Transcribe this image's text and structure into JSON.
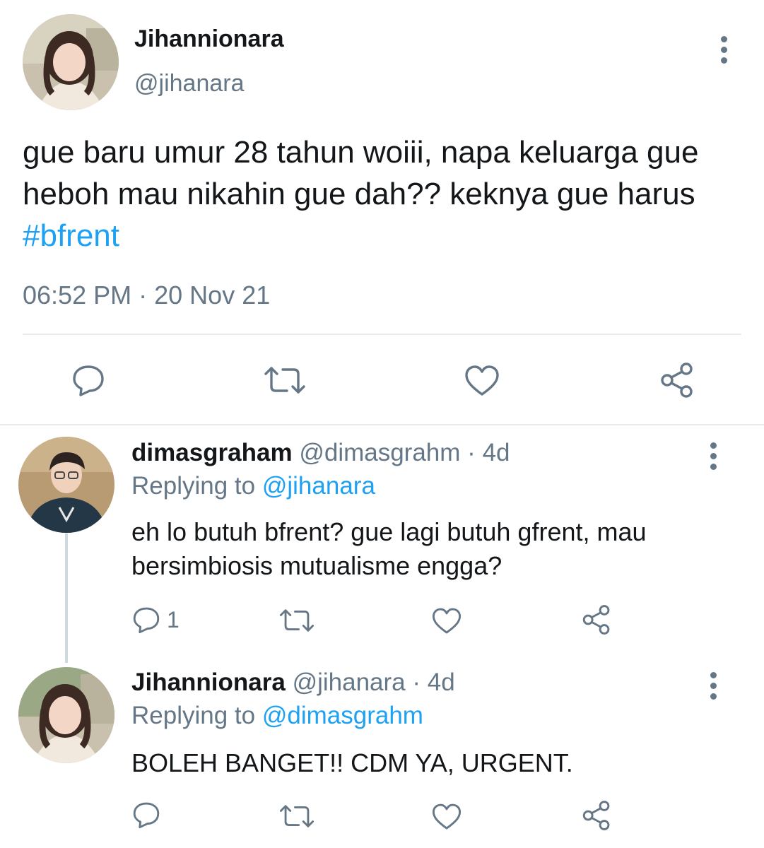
{
  "main_tweet": {
    "display_name": "Jihannionara",
    "handle": "@jihanara",
    "text_plain": "gue baru umur 28 tahun woiii, napa keluarga gue heboh mau nikahin gue dah?? keknya gue harus ",
    "hashtag": "#bfrent",
    "time": "06:52 PM",
    "separator": "·",
    "date": "20 Nov 21",
    "actions": {
      "reply": "reply-icon",
      "retweet": "retweet-icon",
      "like": "heart-icon",
      "share": "share-icon"
    }
  },
  "replies": [
    {
      "display_name": "dimasgraham",
      "handle": "@dimasgrahm",
      "separator": "·",
      "age": "4d",
      "replying_prefix": "Replying to",
      "replying_to": "@jihanara",
      "text": "eh lo butuh bfrent? gue lagi butuh gfrent, mau bersimbiosis mutualisme engga?",
      "reply_count": "1"
    },
    {
      "display_name": "Jihannionara",
      "handle": "@jihanara",
      "separator": "·",
      "age": "4d",
      "replying_prefix": "Replying to",
      "replying_to": "@dimasgrahm",
      "text": "BOLEH BANGET!! CDM YA, URGENT.",
      "reply_count": ""
    }
  ],
  "colors": {
    "text": "#14171a",
    "muted": "#657786",
    "link": "#1da1f2",
    "divider": "#e6ecf0"
  }
}
